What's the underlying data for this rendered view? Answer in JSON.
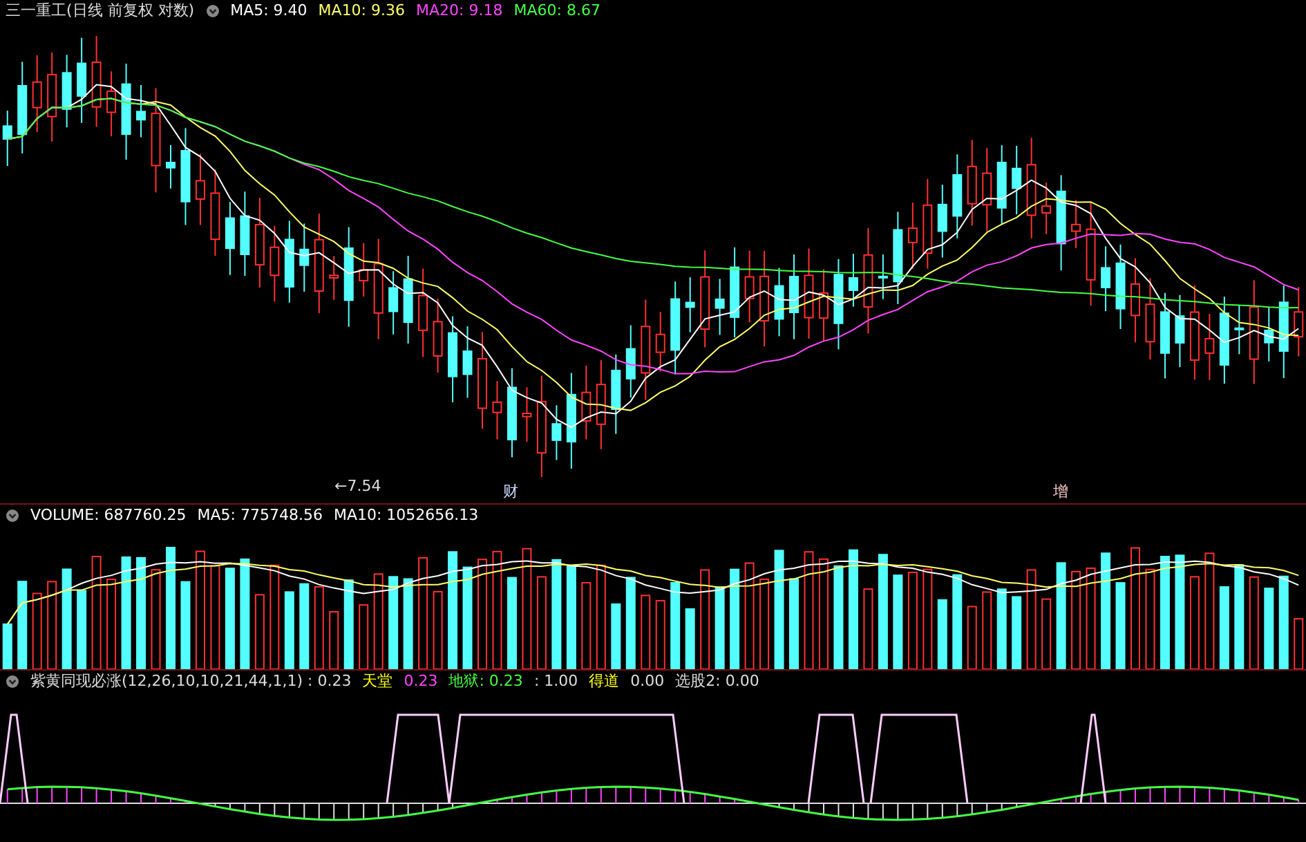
{
  "price_panel": {
    "title": "三一重工(日线 前复权 对数)",
    "indicators": [
      {
        "label": "MA5: 9.40",
        "color": "#ffffff"
      },
      {
        "label": "MA10: 9.36",
        "color": "#ffff66"
      },
      {
        "label": "MA20: 9.18",
        "color": "#ff44ff"
      },
      {
        "label": "MA60: 8.67",
        "color": "#44ff44"
      }
    ],
    "low_marker": "←7.54",
    "event_marks": [
      "财",
      "增"
    ]
  },
  "volume_panel": {
    "indicators": [
      {
        "label": "VOLUME: 687760.25",
        "color": "#ffffff"
      },
      {
        "label": "MA5: 775748.56",
        "color": "#ffffff"
      },
      {
        "label": "MA10: 1052656.13",
        "color": "#ffffff"
      }
    ]
  },
  "signal_panel": {
    "indicators": [
      {
        "label": "紫黄同现必涨(12,26,10,10,21,44,1,1) : 0.23",
        "color": "#dddddd"
      },
      {
        "label": "天堂",
        "color": "#ffff00"
      },
      {
        "label": "0.23",
        "color": "#ff44ff"
      },
      {
        "label": "地狱: 0.23",
        "color": "#44ff44"
      },
      {
        "label": ": 1.00",
        "color": "#dddddd"
      },
      {
        "label": "得道",
        "color": "#ffff00"
      },
      {
        "label": "0.00",
        "color": "#dddddd"
      },
      {
        "label": "选股2: 0.00",
        "color": "#dddddd"
      }
    ]
  }
}
